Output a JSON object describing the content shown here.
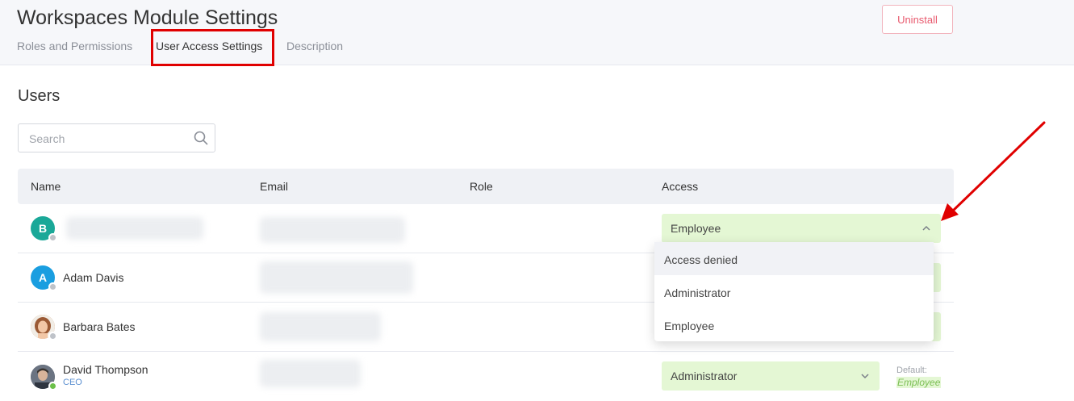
{
  "header": {
    "title": "Workspaces Module Settings",
    "tabs": [
      "Roles and Permissions",
      "User Access Settings",
      "Description"
    ],
    "uninstall_label": "Uninstall"
  },
  "users_section": {
    "title": "Users",
    "search_placeholder": "Search"
  },
  "table": {
    "columns": [
      "Name",
      "Email",
      "Role",
      "Access"
    ],
    "rows": [
      {
        "initial": "B",
        "name": "",
        "subtitle": "",
        "access": "Employee",
        "avatar_color": "#1aa898"
      },
      {
        "initial": "A",
        "name": "Adam Davis",
        "subtitle": "",
        "access": "",
        "avatar_color": "#1a9ee0"
      },
      {
        "initial": "",
        "name": "Barbara Bates",
        "subtitle": "",
        "access": "",
        "avatar_color": "#d9a27a"
      },
      {
        "initial": "",
        "name": "David Thompson",
        "subtitle": "CEO",
        "access": "Administrator",
        "avatar_color": "#5a6170",
        "default_label": "Default:",
        "default_value": "Employee"
      }
    ]
  },
  "dropdown": {
    "options": [
      "Access denied",
      "Administrator",
      "Employee"
    ]
  },
  "colors": {
    "accent_red": "#e00000",
    "access_green": "#e4f7d4",
    "uninstall_text": "#e85a6e"
  }
}
